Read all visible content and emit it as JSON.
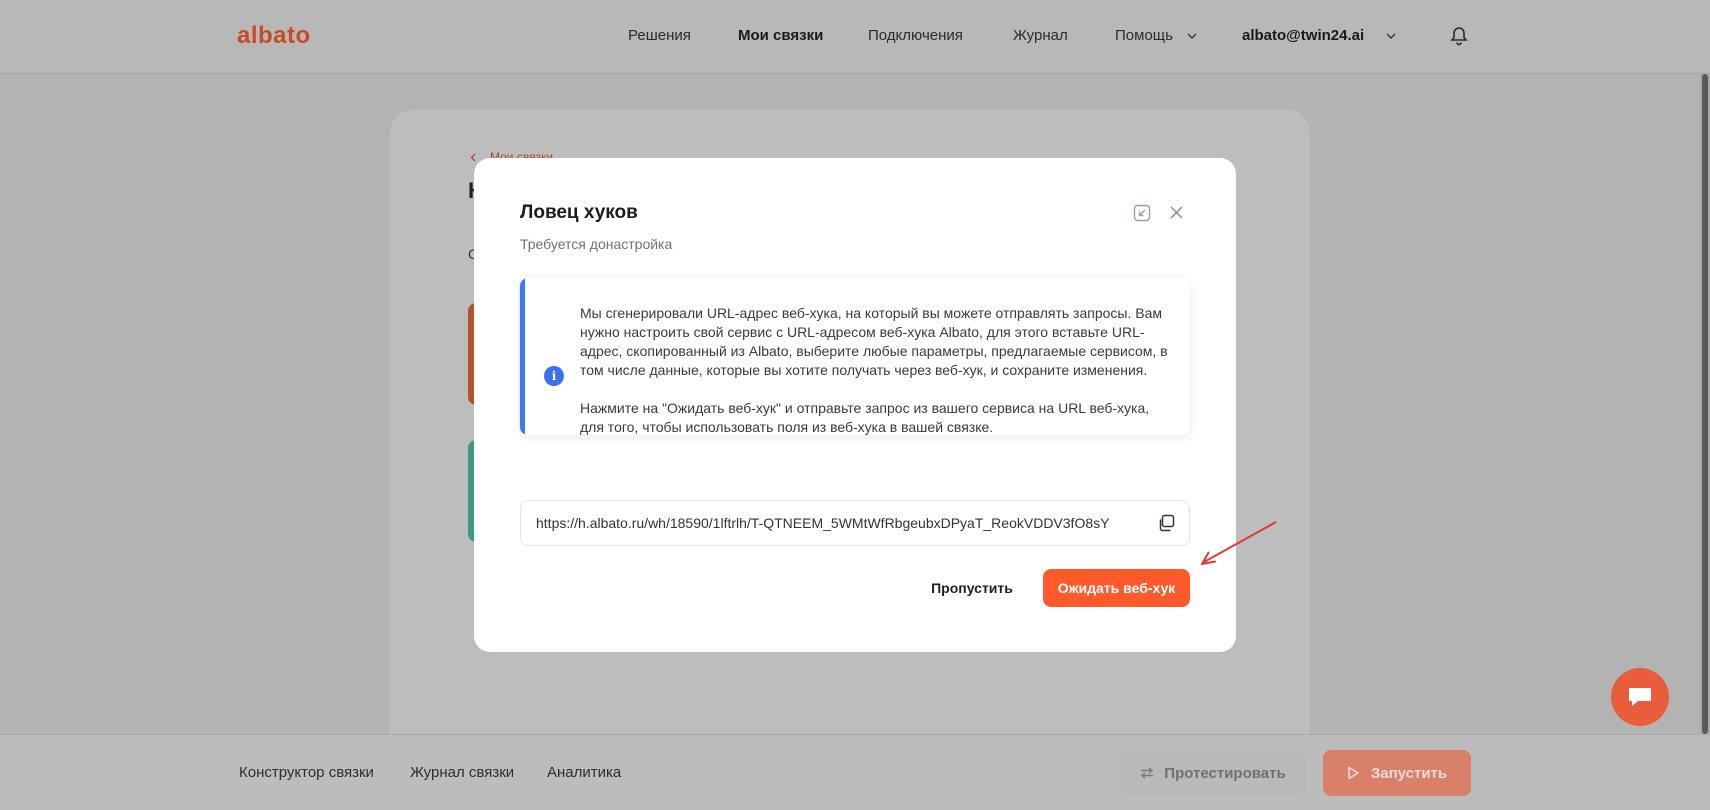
{
  "header": {
    "logo": "albato",
    "nav": [
      "Решения",
      "Мои связки",
      "Подключения",
      "Журнал",
      "Помощь"
    ],
    "user": "albato@twin24.ai"
  },
  "background": {
    "breadcrumb": "Мои связки",
    "heading_fragment": "К",
    "text_fragment": "С"
  },
  "bottom_bar": {
    "tabs": [
      "Конструктор связки",
      "Журнал связки",
      "Аналитика"
    ],
    "test_label": "Протестировать",
    "run_label": "Запустить"
  },
  "modal": {
    "title": "Ловец хуков",
    "subtitle": "Требуется донастройка",
    "info_p1": "Мы сгенерировали URL-адрес веб-хука, на который вы можете отправлять запросы. Вам нужно настроить свой сервис с URL-адресом веб-хука Albato, для этого вставьте URL-адрес, скопированный из Albato, выберите любые параметры, предлагаемые сервисом, в том числе данные, которые вы хотите получать через веб-хук, и сохраните изменения.",
    "info_p2": "Нажмите на \"Ожидать веб-хук\" и отправьте запрос из вашего сервиса на URL веб-хука, для того, чтобы использовать поля из веб-хука в вашей связке.",
    "url": "https://h.albato.ru/wh/18590/1lftrlh/T-QTNEEM_5WMtWfRbgeubxDPyaT_ReokVDDV3fO8sY",
    "skip_label": "Пропустить",
    "wait_label": "Ожидать веб-хук"
  },
  "colors": {
    "accent": "#ff5a2c",
    "info_blue": "#3b7bf6",
    "annotation_arrow": "#e03a34"
  }
}
